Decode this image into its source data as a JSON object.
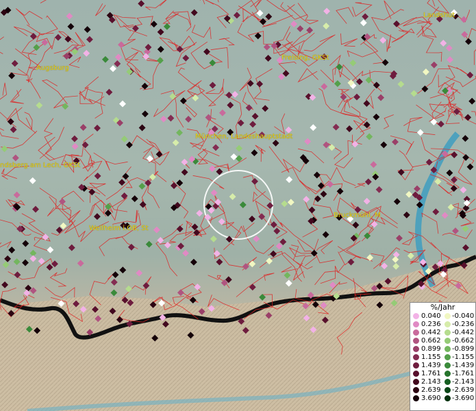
{
  "map": {
    "cities": [
      {
        "name": "Landshut"
      },
      {
        "name": "Freising, GKSt"
      },
      {
        "name": "Augsburg"
      },
      {
        "name": "München, Landeshauptstadt"
      },
      {
        "name": "ndsberg am Lech, GKSt"
      },
      {
        "name": "Weilheim i.OB, St"
      },
      {
        "name": "Bruckmühl, M"
      }
    ]
  },
  "legend": {
    "title": "%/Jahr",
    "positive": [
      {
        "label": "0.040",
        "color": "#f2b2e6"
      },
      {
        "label": "0.236",
        "color": "#e08ac4"
      },
      {
        "label": "0.442",
        "color": "#c96a9c"
      },
      {
        "label": "0.662",
        "color": "#b05480"
      },
      {
        "label": "0.899",
        "color": "#9a3f68"
      },
      {
        "label": "1.155",
        "color": "#842c52"
      },
      {
        "label": "1.439",
        "color": "#6e1c3e"
      },
      {
        "label": "1.761",
        "color": "#58102c"
      },
      {
        "label": "2.143",
        "color": "#42081e"
      },
      {
        "label": "2.639",
        "color": "#2c0412"
      },
      {
        "label": "3.690",
        "color": "#140008"
      }
    ],
    "negative": [
      {
        "label": "-0.040",
        "color": "#f1f7c2"
      },
      {
        "label": "-0.236",
        "color": "#d6ecaa"
      },
      {
        "label": "-0.442",
        "color": "#b5dc8e"
      },
      {
        "label": "-0.662",
        "color": "#95cb76"
      },
      {
        "label": "-0.899",
        "color": "#73b65e"
      },
      {
        "label": "-1.155",
        "color": "#54a04a"
      },
      {
        "label": "-1.439",
        "color": "#3a8a3a"
      },
      {
        "label": "-1.761",
        "color": "#26742c"
      },
      {
        "label": "-2.143",
        "color": "#155e20"
      },
      {
        "label": "-2.639",
        "color": "#0a4616"
      },
      {
        "label": "-3.690",
        "color": "#02300c"
      }
    ]
  }
}
